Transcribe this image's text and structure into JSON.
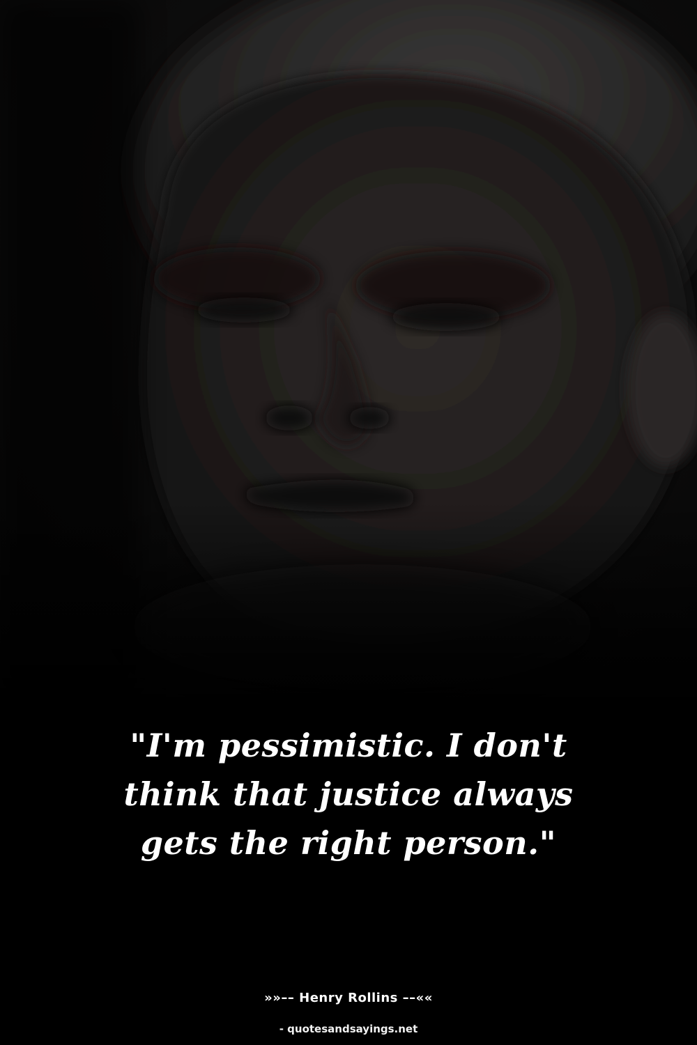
{
  "quote": {
    "text": "\"I'm pessimistic. I don't think that justice always gets the right person.\""
  },
  "author": {
    "line": "»»–– Henry Rollins ––««"
  },
  "source": {
    "text": "- quotesandsayings.net"
  },
  "colors": {
    "background": "#000000",
    "text": "#ffffff"
  }
}
